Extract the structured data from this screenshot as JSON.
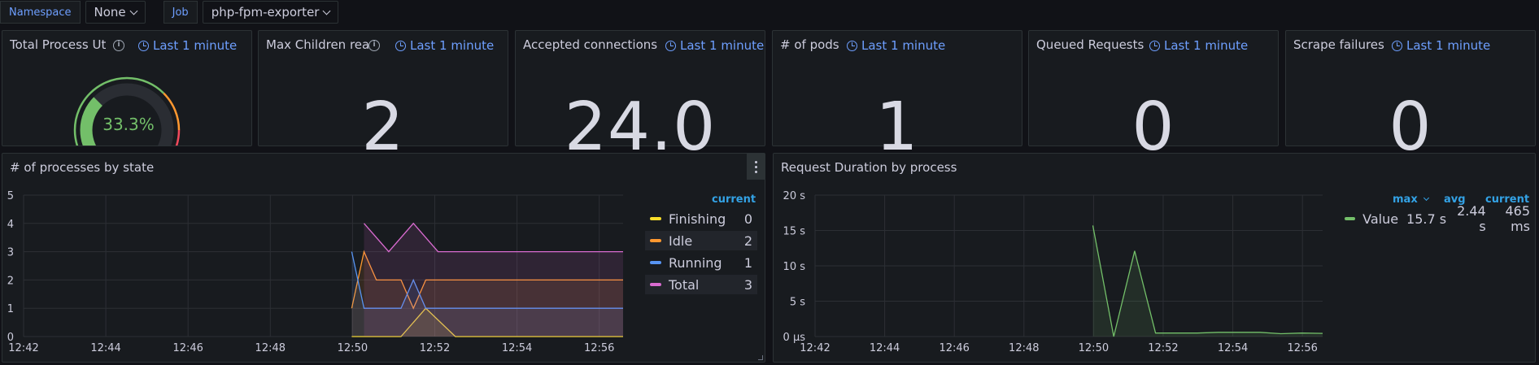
{
  "variables": [
    {
      "label": "Namespace",
      "value": "None"
    },
    {
      "label": "Job",
      "value": "php-fpm-exporter"
    }
  ],
  "time_info": "Last 1 minute",
  "stats": {
    "process_util": {
      "title": "Total Process Utilization",
      "value": "33.3%",
      "percent": 33.3
    },
    "max_children": {
      "title": "Max Children reached",
      "value": "2"
    },
    "accepted": {
      "title": "Accepted connections",
      "value": "24.0"
    },
    "pods": {
      "title": "# of pods",
      "value": "1"
    },
    "queued": {
      "title": "Queued Requests",
      "value": "0"
    },
    "scrape": {
      "title": "Scrape failures",
      "value": "0"
    }
  },
  "colors": {
    "green": "#73bf69",
    "yellow": "#fade2a",
    "orange": "#ff9830",
    "blue": "#5794f2",
    "purple": "#b877d9",
    "red": "#f2495c",
    "link": "#6e9fff"
  },
  "chart_processes": {
    "title": "# of processes by state",
    "legend_header": "current",
    "legend": [
      {
        "name": "Finishing",
        "current": "0",
        "color": "#fade2a"
      },
      {
        "name": "Idle",
        "current": "2",
        "color": "#ff9830"
      },
      {
        "name": "Running",
        "current": "1",
        "color": "#5794f2"
      },
      {
        "name": "Total",
        "current": "3",
        "color": "#d96bd0"
      }
    ]
  },
  "chart_duration": {
    "title": "Request Duration by process",
    "legend_headers": {
      "max": "max",
      "avg": "avg",
      "current": "current"
    },
    "legend": [
      {
        "name": "Value",
        "max": "15.7 s",
        "avg": "2.44 s",
        "current": "465 ms",
        "color": "#73bf69"
      }
    ]
  },
  "chart_data": [
    {
      "type": "line",
      "title": "# of processes by state",
      "x_ticks": [
        "12:42",
        "12:44",
        "12:46",
        "12:48",
        "12:50",
        "12:52",
        "12:54",
        "12:56"
      ],
      "y_ticks": [
        "0",
        "1",
        "2",
        "3",
        "4",
        "5"
      ],
      "ylim": [
        0,
        5
      ],
      "x_range": [
        12.7,
        12.943
      ],
      "series": [
        {
          "name": "Finishing",
          "x": [
            12.833,
            12.843,
            12.853,
            12.863,
            12.875,
            12.943
          ],
          "y": [
            0,
            0,
            0,
            1,
            0,
            0
          ]
        },
        {
          "name": "Idle",
          "x": [
            12.833,
            12.838,
            12.843,
            12.853,
            12.858,
            12.863,
            12.943
          ],
          "y": [
            1,
            3,
            2,
            2,
            1,
            2,
            2
          ]
        },
        {
          "name": "Running",
          "x": [
            12.833,
            12.838,
            12.843,
            12.853,
            12.858,
            12.863,
            12.943
          ],
          "y": [
            3,
            1,
            1,
            1,
            2,
            1,
            1
          ]
        },
        {
          "name": "Total",
          "x": [
            12.838,
            12.848,
            12.858,
            12.868,
            12.943
          ],
          "y": [
            4,
            3,
            4,
            3,
            3
          ]
        }
      ]
    },
    {
      "type": "line",
      "title": "Request Duration by process",
      "x_ticks": [
        "12:42",
        "12:44",
        "12:46",
        "12:48",
        "12:50",
        "12:52",
        "12:54",
        "12:56"
      ],
      "y_ticks": [
        "0 μs",
        "5 s",
        "10 s",
        "15 s",
        "20 s"
      ],
      "ylim": [
        0,
        20
      ],
      "x_range": [
        12.7,
        12.943
      ],
      "series": [
        {
          "name": "Value",
          "x": [
            12.833,
            12.843,
            12.853,
            12.863,
            12.873,
            12.883,
            12.893,
            12.903,
            12.913,
            12.923,
            12.933,
            12.943
          ],
          "y": [
            15.7,
            0,
            12.1,
            0.5,
            0.5,
            0.5,
            0.6,
            0.6,
            0.6,
            0.4,
            0.5,
            0.45
          ]
        }
      ]
    }
  ]
}
